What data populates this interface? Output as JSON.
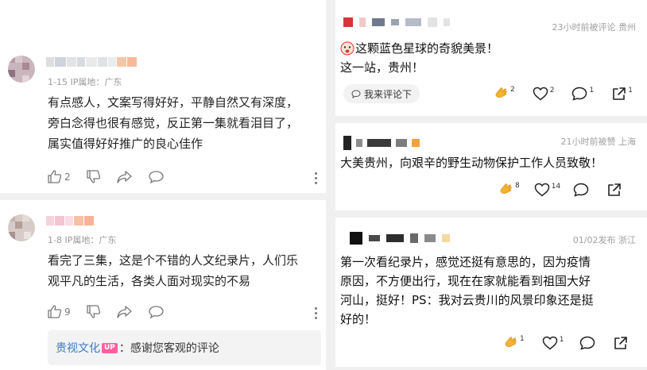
{
  "left": {
    "comments": [
      {
        "meta": "1-15  IP属地：广东",
        "lines": [
          "有点感人，文案写得好好，平静自然又有深度，",
          "旁白念得也很有感觉，反正第一集就看泪目了，",
          "属实值得好好推广的良心佳作"
        ],
        "likes": "2"
      },
      {
        "meta": "1-8  IP属地：广东",
        "lines": [
          "看完了三集，这是个不错的人文纪录片，人们乐",
          "观平凡的生活，各类人面对现实的不易"
        ],
        "likes": "9"
      }
    ],
    "reply": {
      "author": "贵视文化",
      "badge": "UP",
      "text": "：感谢您客观的评论"
    }
  },
  "right": {
    "posts": [
      {
        "time": "23小时前被评论 贵州",
        "lines": [
          "这颗蓝色星球的奇貌美景！",
          "这一站，贵州！"
        ],
        "chip": "我来评论下",
        "counts": {
          "clap": "2",
          "heart": "2",
          "comment": "1",
          "share": "1"
        }
      },
      {
        "time": "21小时前被赞 上海",
        "lines": [
          "大美贵州，向艰辛的野生动物保护工作人员致敬！"
        ],
        "counts": {
          "clap": "8",
          "heart": "14",
          "comment": "",
          "share": ""
        }
      },
      {
        "time": "01/02发布 浙江",
        "lines": [
          "第一次看纪录片，感觉还挺有意思的，因为疫情",
          "原因，不方便出行，现在在家就能看到祖国大好",
          "河山，挺好！PS：我对云贵川的风景印象还是挺",
          "好的！"
        ],
        "counts": {
          "clap": "1",
          "heart": "1",
          "comment": "",
          "share": ""
        }
      }
    ]
  },
  "colors": {
    "link": "#3b78c9",
    "up_badge": "#ff5fa0",
    "clap": "#f2b233",
    "muted": "#9a9a9a"
  }
}
